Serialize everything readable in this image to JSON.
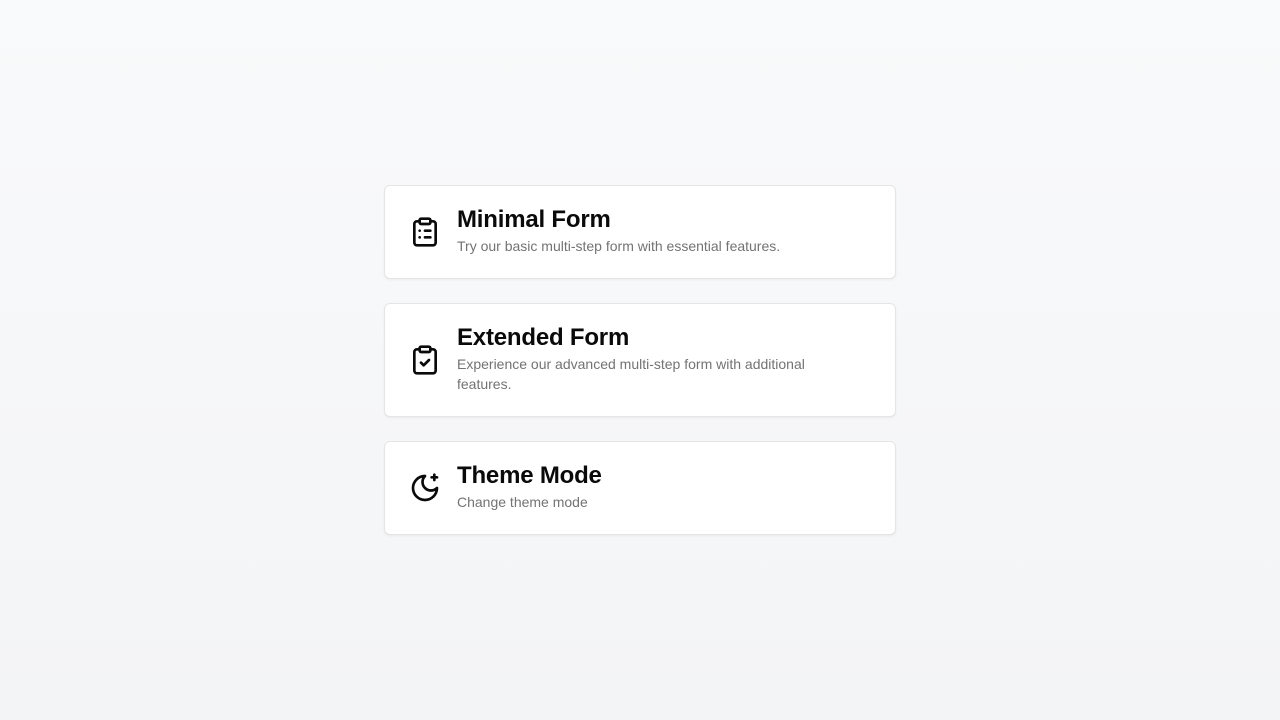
{
  "cards": [
    {
      "icon": "clipboard-list-icon",
      "title": "Minimal Form",
      "description": "Try our basic multi-step form with essential features."
    },
    {
      "icon": "clipboard-check-icon",
      "title": "Extended Form",
      "description": "Experience our advanced multi-step form with additional features."
    },
    {
      "icon": "moon-plus-icon",
      "title": "Theme Mode",
      "description": "Change theme mode"
    }
  ],
  "colors": {
    "background": "#f3f4f6",
    "card": "#ffffff",
    "title": "#0a0a0a",
    "description": "#737373",
    "border": "#e5e5e5"
  }
}
